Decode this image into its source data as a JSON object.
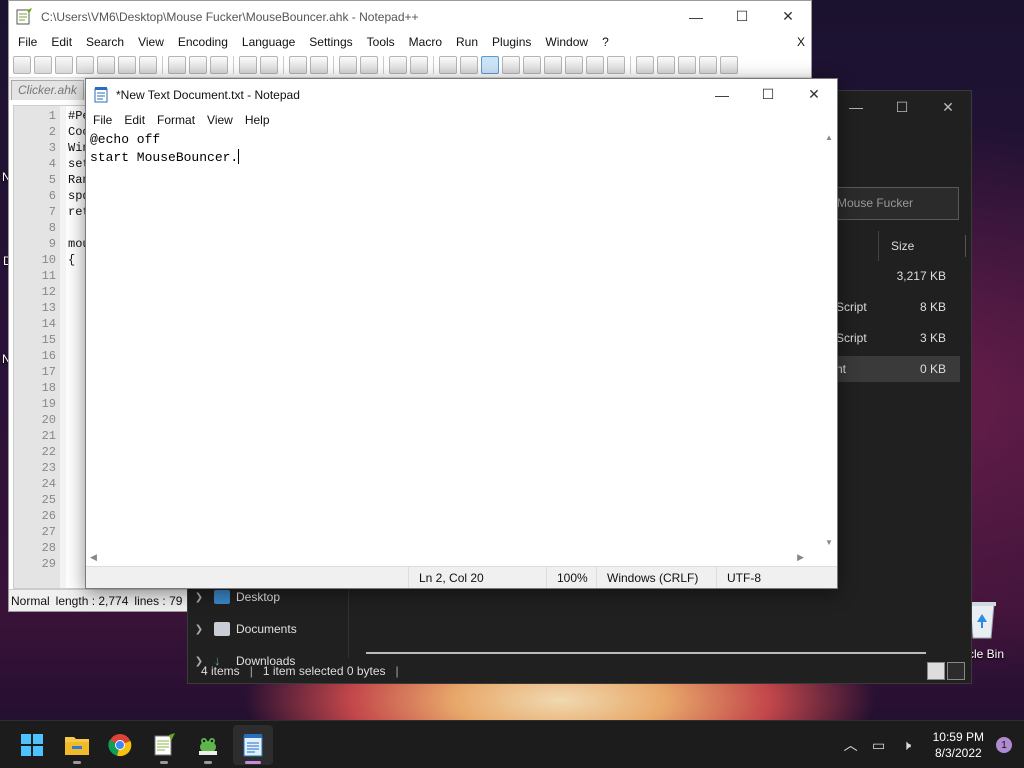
{
  "desktop": {
    "left_labels": [
      "N",
      "D",
      "N"
    ],
    "recycle_bin_label": "cle Bin"
  },
  "notepadpp": {
    "title": "C:\\Users\\VM6\\Desktop\\Mouse Fucker\\MouseBouncer.ahk - Notepad++",
    "menu": [
      "File",
      "Edit",
      "Search",
      "View",
      "Encoding",
      "Language",
      "Settings",
      "Tools",
      "Macro",
      "Run",
      "Plugins",
      "Window",
      "?"
    ],
    "menu_close": "X",
    "tab_label": "Clicker.ahk",
    "line_numbers": [
      "1",
      "2",
      "3",
      "4",
      "5",
      "6",
      "7",
      "8",
      "9",
      "10",
      "11",
      "12",
      "13",
      "14",
      "15",
      "16",
      "17",
      "18",
      "19",
      "20",
      "21",
      "22",
      "23",
      "24",
      "25",
      "26",
      "27",
      "28",
      "29"
    ],
    "code_lines": [
      "#Pe",
      "Coo",
      "Win",
      "set",
      "Ran",
      "spd",
      "ret",
      "",
      "mou",
      "{"
    ],
    "status": {
      "mode": "Normal",
      "length": "length : 2,774",
      "lines": "lines : 79"
    }
  },
  "explorer": {
    "search_placeholder": "Mouse Fucker",
    "column_size": "Size",
    "rows": [
      {
        "type": "",
        "size": "3,217 KB",
        "selected": false
      },
      {
        "type": "Script",
        "size": "8 KB",
        "selected": false
      },
      {
        "type": "Script",
        "size": "3 KB",
        "selected": false
      },
      {
        "type": "nt",
        "size": "0 KB",
        "selected": true
      }
    ],
    "nav": [
      "Desktop",
      "Documents",
      "Downloads"
    ],
    "status": {
      "items": "4 items",
      "selected": "1 item selected  0 bytes"
    }
  },
  "notepad": {
    "title": "*New Text Document.txt - Notepad",
    "menu": [
      "File",
      "Edit",
      "Format",
      "View",
      "Help"
    ],
    "content_line1": "@echo off",
    "content_line2": "start MouseBouncer.",
    "status": {
      "position": "Ln 2, Col 20",
      "zoom": "100%",
      "line_ending": "Windows (CRLF)",
      "encoding": "UTF-8"
    }
  },
  "taskbar": {
    "apps": [
      "start-icon",
      "file-explorer-icon",
      "chrome-icon",
      "notepadpp-icon",
      "autohotkey-icon",
      "notepad-icon"
    ],
    "time": "10:59 PM",
    "date": "8/3/2022",
    "notification_count": "1",
    "colors": {
      "accent": "#c88bd8",
      "taskbar": "#1c1c1c"
    }
  }
}
